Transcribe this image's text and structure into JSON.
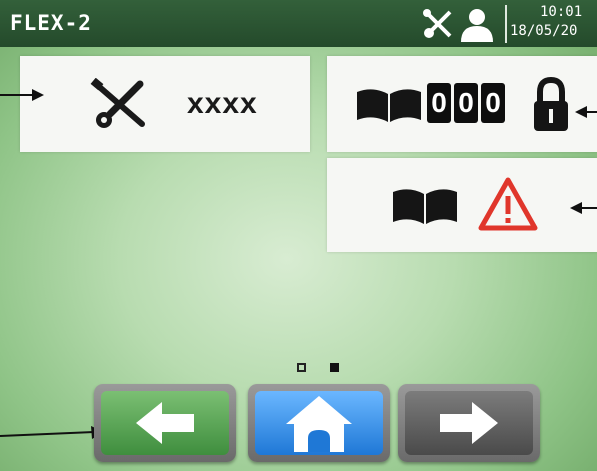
{
  "header": {
    "title": "FLEX-2",
    "time": "10:01",
    "date": "18/05/20",
    "icons": [
      "tools-icon",
      "user-icon"
    ]
  },
  "service_panel": {
    "icon": "tools-icon",
    "code": "xxxx"
  },
  "counter_panel": {
    "icon": "book-icon",
    "digits": [
      "0",
      "0",
      "0"
    ],
    "lock_icon": "padlock-icon"
  },
  "warning_panel": {
    "icons": [
      "book-icon",
      "warning-triangle-icon"
    ]
  },
  "pager": {
    "pages": 2,
    "current_page": 2
  },
  "nav": {
    "back_icon": "arrow-left-icon",
    "home_icon": "home-icon",
    "next_icon": "arrow-right-icon"
  },
  "colors": {
    "header_bg": "#2c5833",
    "background": "#b8dcb0",
    "panel_bg": "#f6f7f4",
    "back_button": "#4fa04d",
    "home_button": "#2f8cec",
    "next_button": "#5a5a5a",
    "warning_red": "#e0362b"
  }
}
